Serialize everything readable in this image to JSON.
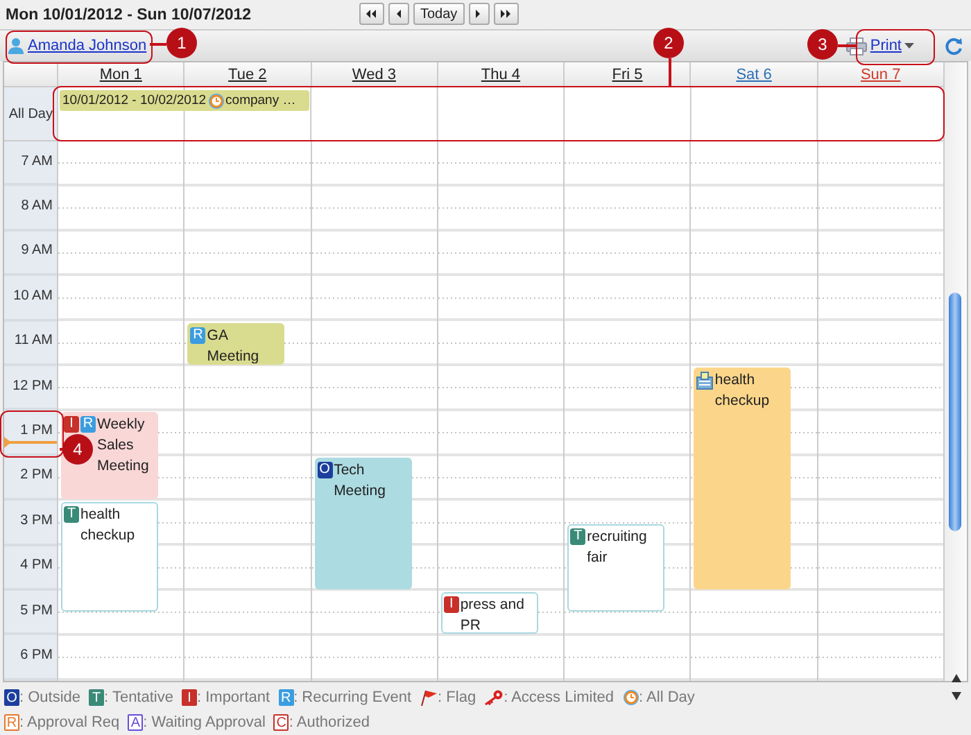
{
  "title": "Mon 10/01/2012 - Sun 10/07/2012",
  "nav": {
    "today": "Today"
  },
  "toolbar": {
    "user": "Amanda Johnson",
    "print": "Print"
  },
  "all_day_label": "All Day",
  "hours": [
    {
      "label": "7 AM",
      "current": false
    },
    {
      "label": "8 AM",
      "current": false
    },
    {
      "label": "9 AM",
      "current": false
    },
    {
      "label": "10 AM",
      "current": false
    },
    {
      "label": "11 AM",
      "current": false
    },
    {
      "label": "12 PM",
      "current": false
    },
    {
      "label": "1 PM",
      "current": true
    },
    {
      "label": "2 PM",
      "current": false
    },
    {
      "label": "3 PM",
      "current": false
    },
    {
      "label": "4 PM",
      "current": false
    },
    {
      "label": "5 PM",
      "current": false
    },
    {
      "label": "6 PM",
      "current": false
    }
  ],
  "days": [
    {
      "label": "Mon 1",
      "kind": "weekday",
      "all_day": [
        {
          "kind": "event",
          "dates": "10/01/2012 - 10/02/2012",
          "title": "company …",
          "color": "#d9dc8e"
        }
      ],
      "slots": [
        {
          "kind": "free"
        },
        {
          "kind": "free"
        },
        {
          "kind": "free"
        },
        {
          "kind": "free"
        },
        {
          "kind": "free"
        },
        {
          "kind": "free"
        },
        {
          "kind": "free"
        },
        {
          "kind": "free"
        },
        {
          "kind": "free"
        },
        {
          "kind": "free"
        },
        {
          "kind": "free"
        },
        {
          "kind": "free"
        },
        {
          "kind": "event",
          "title": "Weekly Sales Meeting",
          "color": "#f9d7d7",
          "badges": [
            {
              "letter": "I",
              "kind": "important"
            },
            {
              "letter": "R",
              "kind": "recurring"
            }
          ]
        },
        {
          "kind": "continued"
        },
        {
          "kind": "continued"
        },
        {
          "kind": "continued"
        },
        {
          "kind": "event",
          "title": "health checkup",
          "color": "#ffffff",
          "badges": [
            {
              "letter": "T",
              "kind": "tentative"
            }
          ]
        },
        {
          "kind": "continued"
        },
        {
          "kind": "continued"
        },
        {
          "kind": "continued"
        },
        {
          "kind": "continued"
        }
      ]
    },
    {
      "label": "Tue 2",
      "kind": "weekday",
      "all_day": [
        {
          "kind": "continued"
        }
      ],
      "slots": [
        {
          "kind": "free"
        },
        {
          "kind": "free"
        },
        {
          "kind": "free"
        },
        {
          "kind": "free"
        },
        {
          "kind": "free"
        },
        {
          "kind": "free"
        },
        {
          "kind": "free"
        },
        {
          "kind": "free"
        },
        {
          "kind": "event",
          "title": "GA Meeting",
          "color": "#d9dc8e",
          "badges": [
            {
              "letter": "R",
              "kind": "recurring"
            }
          ]
        },
        {
          "kind": "continued"
        }
      ]
    },
    {
      "label": "Wed 3",
      "kind": "weekday",
      "slots": [
        {
          "kind": "free"
        },
        {
          "kind": "free"
        },
        {
          "kind": "free"
        },
        {
          "kind": "free"
        },
        {
          "kind": "free"
        },
        {
          "kind": "free"
        },
        {
          "kind": "free"
        },
        {
          "kind": "free"
        },
        {
          "kind": "free"
        },
        {
          "kind": "free"
        },
        {
          "kind": "free"
        },
        {
          "kind": "free"
        },
        {
          "kind": "free"
        },
        {
          "kind": "free"
        },
        {
          "kind": "event",
          "title": "Tech Meeting",
          "color": "#acdbe1",
          "badges": [
            {
              "letter": "O",
              "kind": "outside"
            }
          ]
        },
        {
          "kind": "continued"
        },
        {
          "kind": "continued"
        },
        {
          "kind": "continued"
        },
        {
          "kind": "continued"
        },
        {
          "kind": "continued"
        }
      ]
    },
    {
      "label": "Thu 4",
      "kind": "weekday",
      "slots": [
        {
          "kind": "free"
        },
        {
          "kind": "free"
        },
        {
          "kind": "free"
        },
        {
          "kind": "free"
        },
        {
          "kind": "free"
        },
        {
          "kind": "free"
        },
        {
          "kind": "free"
        },
        {
          "kind": "free"
        },
        {
          "kind": "free"
        },
        {
          "kind": "free"
        },
        {
          "kind": "free"
        },
        {
          "kind": "free"
        },
        {
          "kind": "free"
        },
        {
          "kind": "free"
        },
        {
          "kind": "free"
        },
        {
          "kind": "free"
        },
        {
          "kind": "free"
        },
        {
          "kind": "free"
        },
        {
          "kind": "free"
        },
        {
          "kind": "free"
        },
        {
          "kind": "event",
          "title": "press and PR",
          "color": "#ffffff",
          "badges": [
            {
              "letter": "I",
              "kind": "important"
            }
          ]
        },
        {
          "kind": "continued"
        }
      ]
    },
    {
      "label": "Fri 5",
      "kind": "weekday",
      "slots": [
        {
          "kind": "free"
        },
        {
          "kind": "free"
        },
        {
          "kind": "free"
        },
        {
          "kind": "free"
        },
        {
          "kind": "free"
        },
        {
          "kind": "free"
        },
        {
          "kind": "free"
        },
        {
          "kind": "free"
        },
        {
          "kind": "free"
        },
        {
          "kind": "free"
        },
        {
          "kind": "free"
        },
        {
          "kind": "free"
        },
        {
          "kind": "free"
        },
        {
          "kind": "free"
        },
        {
          "kind": "free"
        },
        {
          "kind": "free"
        },
        {
          "kind": "free"
        },
        {
          "kind": "event",
          "title": "recruiting fair",
          "color": "#ffffff",
          "badges": [
            {
              "letter": "T",
              "kind": "tentative"
            }
          ]
        },
        {
          "kind": "continued"
        },
        {
          "kind": "continued"
        },
        {
          "kind": "continued"
        }
      ]
    },
    {
      "label": "Sat 6",
      "kind": "saturday",
      "slots": [
        {
          "kind": "free"
        },
        {
          "kind": "free"
        },
        {
          "kind": "free"
        },
        {
          "kind": "free"
        },
        {
          "kind": "free"
        },
        {
          "kind": "free"
        },
        {
          "kind": "free"
        },
        {
          "kind": "free"
        },
        {
          "kind": "free"
        },
        {
          "kind": "free"
        },
        {
          "kind": "event",
          "title": "health checkup",
          "color": "#fbd68a",
          "badges": [
            {
              "kind": "facility"
            }
          ]
        },
        {
          "kind": "continued"
        },
        {
          "kind": "continued"
        },
        {
          "kind": "continued"
        },
        {
          "kind": "continued"
        },
        {
          "kind": "continued"
        },
        {
          "kind": "continued"
        },
        {
          "kind": "continued"
        },
        {
          "kind": "continued"
        },
        {
          "kind": "continued"
        }
      ]
    },
    {
      "label": "Sun 7",
      "kind": "sunday"
    }
  ],
  "legend": [
    [
      {
        "kind": "filled",
        "letter": "O",
        "color": "#1c3f9e",
        "label": ": Outside"
      },
      {
        "kind": "filled",
        "letter": "T",
        "color": "#3a8a78",
        "label": ": Tentative"
      },
      {
        "kind": "filled",
        "letter": "I",
        "color": "#c8302a",
        "label": ": Important"
      },
      {
        "kind": "filled",
        "letter": "R",
        "color": "#3b9de0",
        "label": ": Recurring Event"
      },
      {
        "kind": "flag",
        "label": ": Flag"
      },
      {
        "kind": "key",
        "label": ": Access Limited"
      },
      {
        "kind": "clock",
        "label": ": All Day"
      }
    ],
    [
      {
        "kind": "outlined",
        "letter": "R",
        "color": "#e8782a",
        "label": ": Approval Req"
      },
      {
        "kind": "outlined",
        "letter": "A",
        "color": "#6a4fd8",
        "label": ": Waiting Approval"
      },
      {
        "kind": "outlined",
        "letter": "C",
        "color": "#c8302a",
        "label": ": Authorized"
      }
    ]
  ],
  "callouts": [
    {
      "number": "1"
    },
    {
      "number": "2"
    },
    {
      "number": "3"
    },
    {
      "number": "4"
    }
  ]
}
